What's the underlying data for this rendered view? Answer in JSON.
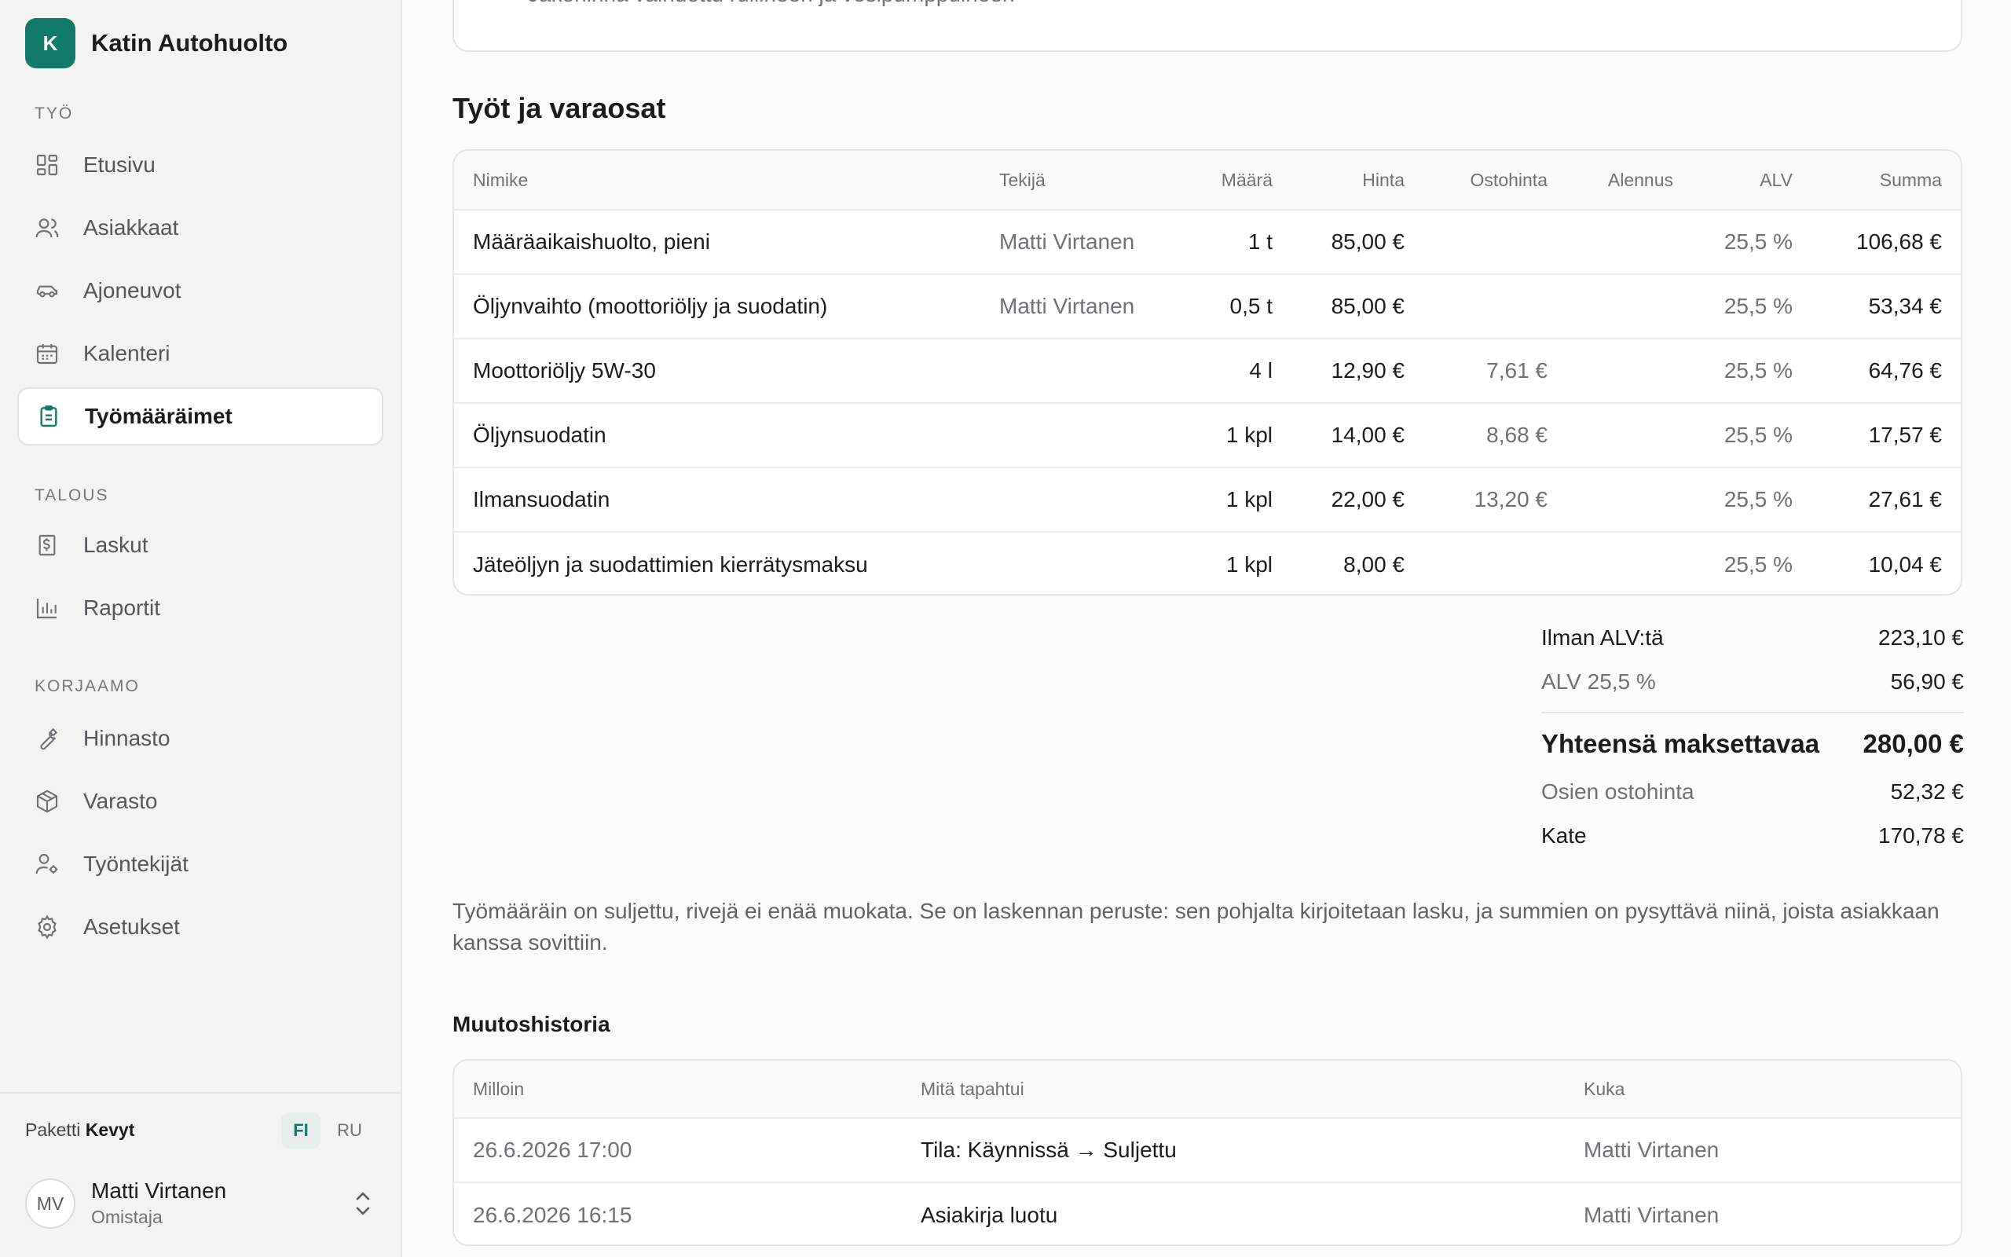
{
  "brand": {
    "logo_letter": "K",
    "name": "Katin Autohuolto",
    "accent": "#127a69"
  },
  "sidebar": {
    "sections": [
      {
        "label": "TYÖ",
        "items": [
          {
            "label": "Etusivu",
            "icon": "dashboard-icon"
          },
          {
            "label": "Asiakkaat",
            "icon": "users-icon"
          },
          {
            "label": "Ajoneuvot",
            "icon": "car-icon"
          },
          {
            "label": "Kalenteri",
            "icon": "calendar-icon"
          },
          {
            "label": "Työmääräimet",
            "icon": "clipboard-icon",
            "active": true
          }
        ]
      },
      {
        "label": "TALOUS",
        "items": [
          {
            "label": "Laskut",
            "icon": "invoice-icon"
          },
          {
            "label": "Raportit",
            "icon": "bar-chart-icon"
          }
        ]
      },
      {
        "label": "KORJAAMO",
        "items": [
          {
            "label": "Hinnasto",
            "icon": "wrench-icon"
          },
          {
            "label": "Varasto",
            "icon": "box-icon"
          },
          {
            "label": "Työntekijät",
            "icon": "user-gear-icon"
          },
          {
            "label": "Asetukset",
            "icon": "gear-icon"
          }
        ]
      }
    ],
    "plan_prefix": "Paketti",
    "plan_name": "Kevyt",
    "languages": [
      "FI",
      "RU"
    ],
    "active_language": "FI",
    "user": {
      "initials": "MV",
      "name": "Matti Virtanen",
      "role": "Omistaja"
    }
  },
  "description_text": "Jakohihna vaihdettu rullineen ja vesipumppuineen",
  "items_section": {
    "title": "Työt ja varaosat",
    "columns": [
      "Nimike",
      "Tekijä",
      "Määrä",
      "Hinta",
      "Ostohinta",
      "Alennus",
      "ALV",
      "Summa"
    ],
    "rows": [
      {
        "name": "Määräaikaishuolto, pieni",
        "worker": "Matti Virtanen",
        "qty": "1 t",
        "price": "85,00 €",
        "cost": "",
        "discount": "",
        "vat": "25,5 %",
        "sum": "106,68 €"
      },
      {
        "name": "Öljynvaihto (moottoriöljy ja suodatin)",
        "worker": "Matti Virtanen",
        "qty": "0,5 t",
        "price": "85,00 €",
        "cost": "",
        "discount": "",
        "vat": "25,5 %",
        "sum": "53,34 €"
      },
      {
        "name": "Moottoriöljy 5W-30",
        "worker": "",
        "qty": "4 l",
        "price": "12,90 €",
        "cost": "7,61 €",
        "discount": "",
        "vat": "25,5 %",
        "sum": "64,76 €"
      },
      {
        "name": "Öljynsuodatin",
        "worker": "",
        "qty": "1 kpl",
        "price": "14,00 €",
        "cost": "8,68 €",
        "discount": "",
        "vat": "25,5 %",
        "sum": "17,57 €"
      },
      {
        "name": "Ilmansuodatin",
        "worker": "",
        "qty": "1 kpl",
        "price": "22,00 €",
        "cost": "13,20 €",
        "discount": "",
        "vat": "25,5 %",
        "sum": "27,61 €"
      },
      {
        "name": "Jäteöljyn ja suodattimien kierrätysmaksu",
        "worker": "",
        "qty": "1 kpl",
        "price": "8,00 €",
        "cost": "",
        "discount": "",
        "vat": "25,5 %",
        "sum": "10,04 €"
      }
    ]
  },
  "totals": {
    "net_label": "Ilman ALV:tä",
    "net": "223,10 €",
    "vat_label": "ALV 25,5 %",
    "vat": "56,90 €",
    "total_label": "Yhteensä maksettavaa",
    "total": "280,00 €",
    "cost_label": "Osien ostohinta",
    "cost": "52,32 €",
    "margin_label": "Kate",
    "margin": "170,78 €"
  },
  "closed_note": "Työmääräin on suljettu, rivejä ei enää muokata. Se on laskennan peruste: sen pohjalta kirjoitetaan lasku, ja summien on pysyttävä niinä, joista asiakkaan kanssa sovittiin.",
  "history": {
    "title": "Muutoshistoria",
    "columns": [
      "Milloin",
      "Mitä tapahtui",
      "Kuka"
    ],
    "rows": [
      {
        "when": "26.6.2026 17:00",
        "what": "Tila: Käynnissä → Suljettu",
        "who": "Matti Virtanen"
      },
      {
        "when": "26.6.2026 16:15",
        "what": "Asiakirja luotu",
        "who": "Matti Virtanen"
      }
    ]
  }
}
